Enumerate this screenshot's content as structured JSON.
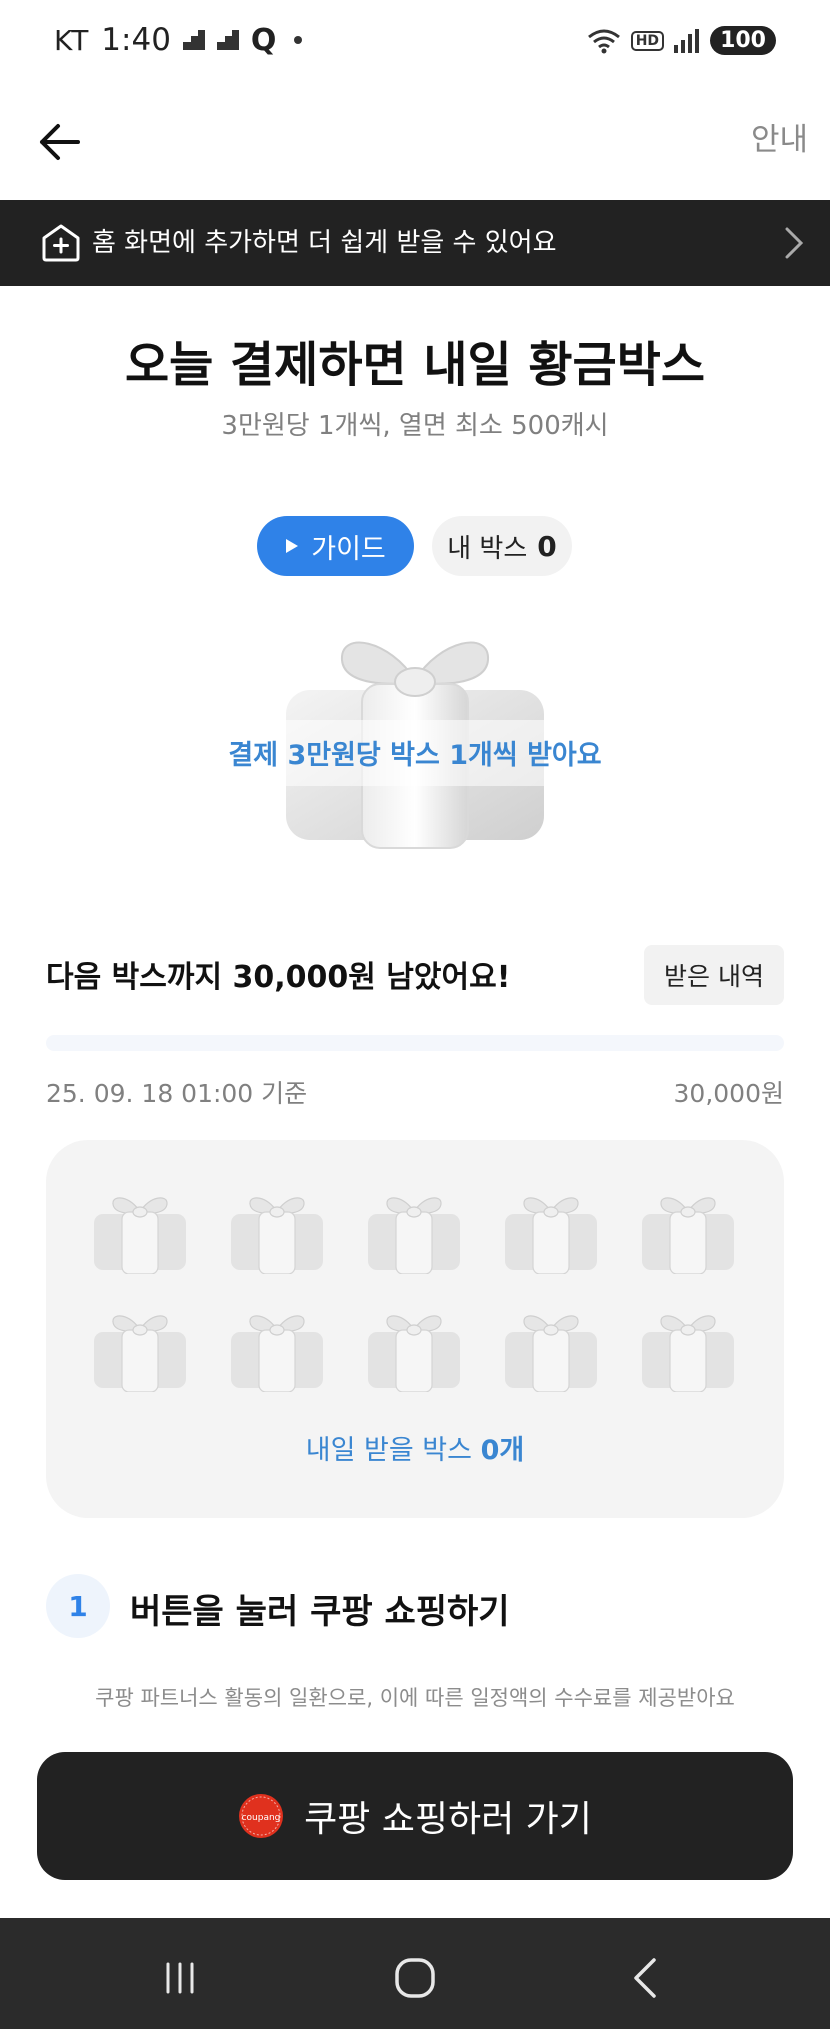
{
  "status_bar": {
    "carrier": "KT",
    "time": "1:40",
    "extra_icon": "Q",
    "battery": "100",
    "hd_label": "HD"
  },
  "header": {
    "info_label": "안내"
  },
  "banner": {
    "text": "홈 화면에 추가하면 더 쉽게 받을 수 있어요"
  },
  "title": "오늘 결제하면 내일 황금박스",
  "subtitle": "3만원당 1개씩, 열면 최소 500캐시",
  "buttons": {
    "guide": "가이드",
    "mybox_label": "내 박스",
    "mybox_count": "0"
  },
  "gift_caption": "결제 3만원당 박스 1개씩 받아요",
  "progress": {
    "remain_text": "다음 박스까지 30,000원 남았어요!",
    "history_label": "받은 내역",
    "fraction": 0,
    "timestamp": "25. 09. 18 01:00 기준",
    "goal": "30,000원"
  },
  "boxes": {
    "count_shown": 10,
    "tomorrow_prefix": "내일 받을 박스 ",
    "tomorrow_count": "0개"
  },
  "step": {
    "number": "1",
    "text": "버튼을 눌러 쿠팡 쇼핑하기"
  },
  "disclaimer": "쿠팡 파트너스 활동의 일환으로, 이에 따른 일정액의 수수료를 제공받아요",
  "cta": {
    "logo_text": "coupang",
    "label": "쿠팡 쇼핑하러 가기"
  },
  "colors": {
    "accent": "#2f82e8",
    "caption_blue": "#3a86d1",
    "dark": "#222222",
    "panel": "#f4f4f4",
    "logo_red": "#e0311e"
  },
  "icons": [
    "back-arrow-icon",
    "home-add-icon",
    "chevron-right-icon",
    "play-icon",
    "gift-icon",
    "coupang-logo-icon",
    "recent-apps-icon",
    "home-icon",
    "back-icon"
  ]
}
